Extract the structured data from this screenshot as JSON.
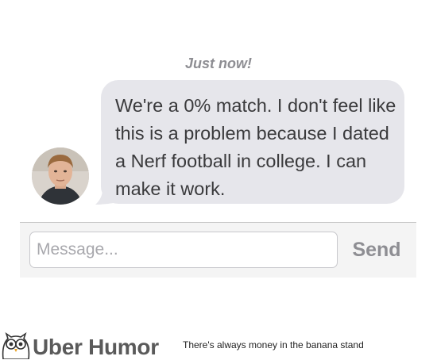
{
  "chat": {
    "timestamp": "Just now!",
    "message": "We're a 0% match. I don't feel like this is a problem because I dated a Nerf football in college. I can make it work."
  },
  "composer": {
    "placeholder": "Message...",
    "send_label": "Send"
  },
  "watermark": {
    "brand": "Uber Humor",
    "tagline": "There's always money in the banana stand"
  },
  "colors": {
    "bubble": "#e6e6eb",
    "timestamp": "#8e8e93",
    "send": "#8e8e93"
  }
}
